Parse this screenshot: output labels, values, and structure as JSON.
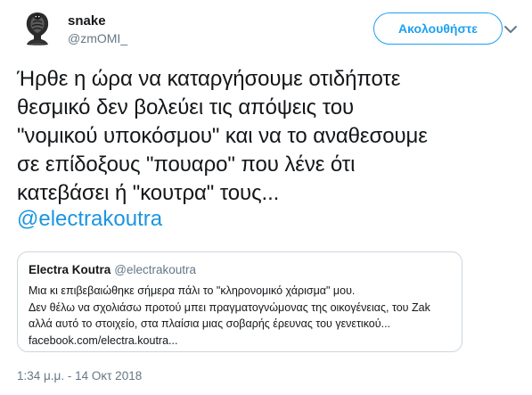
{
  "user": {
    "display_name": "snake",
    "handle": "@zmOMI_"
  },
  "follow_button": {
    "label": "Ακολουθήστε"
  },
  "icons": {
    "avatar": "cobra-avatar-icon",
    "caret": "chevron-down-icon"
  },
  "colors": {
    "accent": "#1da1f2",
    "link": "#1b95e0",
    "secondary_text": "#657786",
    "border": "#ccd6dd"
  },
  "tweet": {
    "text": "Ήρθε η ώρα να καταργήσουμε οτιδήποτε\nθεσμικό δεν βολεύει τις απόψεις του\n\"νομικού υποκόσμου\" και να το αναθεσουμε\nσε επίδοξους \"πουαρο\"  που λένε ότι\nκατεβάσει ή \"κουτρα\" τους...",
    "mention": "@electrakoutra"
  },
  "quoted_tweet": {
    "author_name": "Electra Koutra",
    "author_handle": "@electrakoutra",
    "text": "Μια κι επιβεβαιώθηκε σήμερα πάλι το \"κληρονομικό χάρισμα\" μου.\nΔεν θέλω να σχολιάσω προτού μπει πραγματογνώμονας της οικογένειας, του Zak\nαλλά αυτό το στοιχείο, στα πλαίσια μιας σοβαρής έρευνας του γενετικού...\nfacebook.com/electra.koutra..."
  },
  "timestamp": "1:34 μ.μ. - 14 Οκτ 2018"
}
